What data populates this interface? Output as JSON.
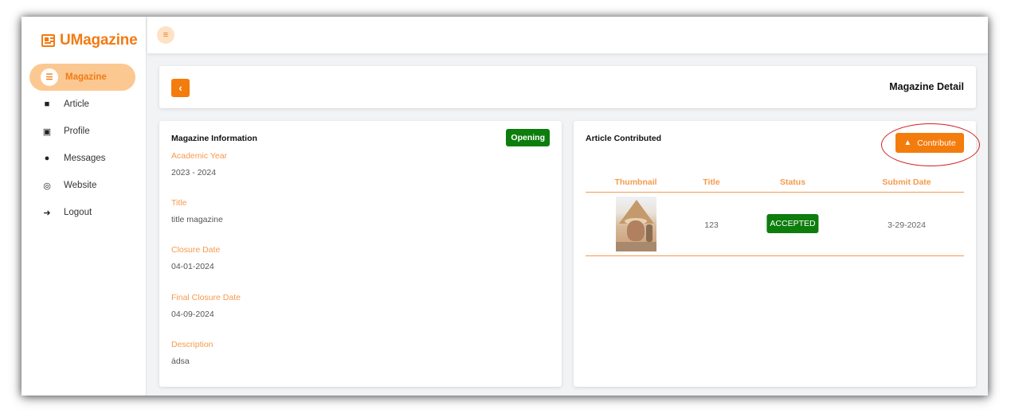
{
  "brand": {
    "name": "UMagazine",
    "icon": "newspaper-icon"
  },
  "sidebar": {
    "items": [
      {
        "label": "Magazine",
        "icon": "layers-icon",
        "active": true
      },
      {
        "label": "Article",
        "icon": "pdf-file-icon"
      },
      {
        "label": "Profile",
        "icon": "id-card-icon"
      },
      {
        "label": "Messages",
        "icon": "messenger-icon"
      },
      {
        "label": "Website",
        "icon": "globe-icon"
      },
      {
        "label": "Logout",
        "icon": "logout-icon"
      }
    ]
  },
  "topbar": {
    "menu_icon": "hamburger-icon"
  },
  "header": {
    "back_icon": "chevron-left-icon",
    "title": "Magazine Detail"
  },
  "info": {
    "title": "Magazine Information",
    "status": "Opening",
    "fields": [
      {
        "label": "Academic Year",
        "value": "2023 - 2024"
      },
      {
        "label": "Title",
        "value": "title magazine"
      },
      {
        "label": "Closure Date",
        "value": "04-01-2024"
      },
      {
        "label": "Final Closure Date",
        "value": "04-09-2024"
      },
      {
        "label": "Description",
        "value": "ádsa"
      }
    ]
  },
  "articles": {
    "title": "Article Contributed",
    "contribute_label": "Contribute",
    "contribute_icon": "hand-user-icon",
    "columns": [
      "Thumbnail",
      "Title",
      "Status",
      "Submit Date"
    ],
    "rows": [
      {
        "thumbnail": "cat-pyramid-thumbnail",
        "title": "123",
        "status": "ACCEPTED",
        "submit_date": "3-29-2024"
      }
    ]
  },
  "colors": {
    "accent": "#f47c0d",
    "accent_light": "#fcc892",
    "label": "#f59a4c",
    "success": "#0d7d0d",
    "highlight_ring": "#d42020"
  }
}
